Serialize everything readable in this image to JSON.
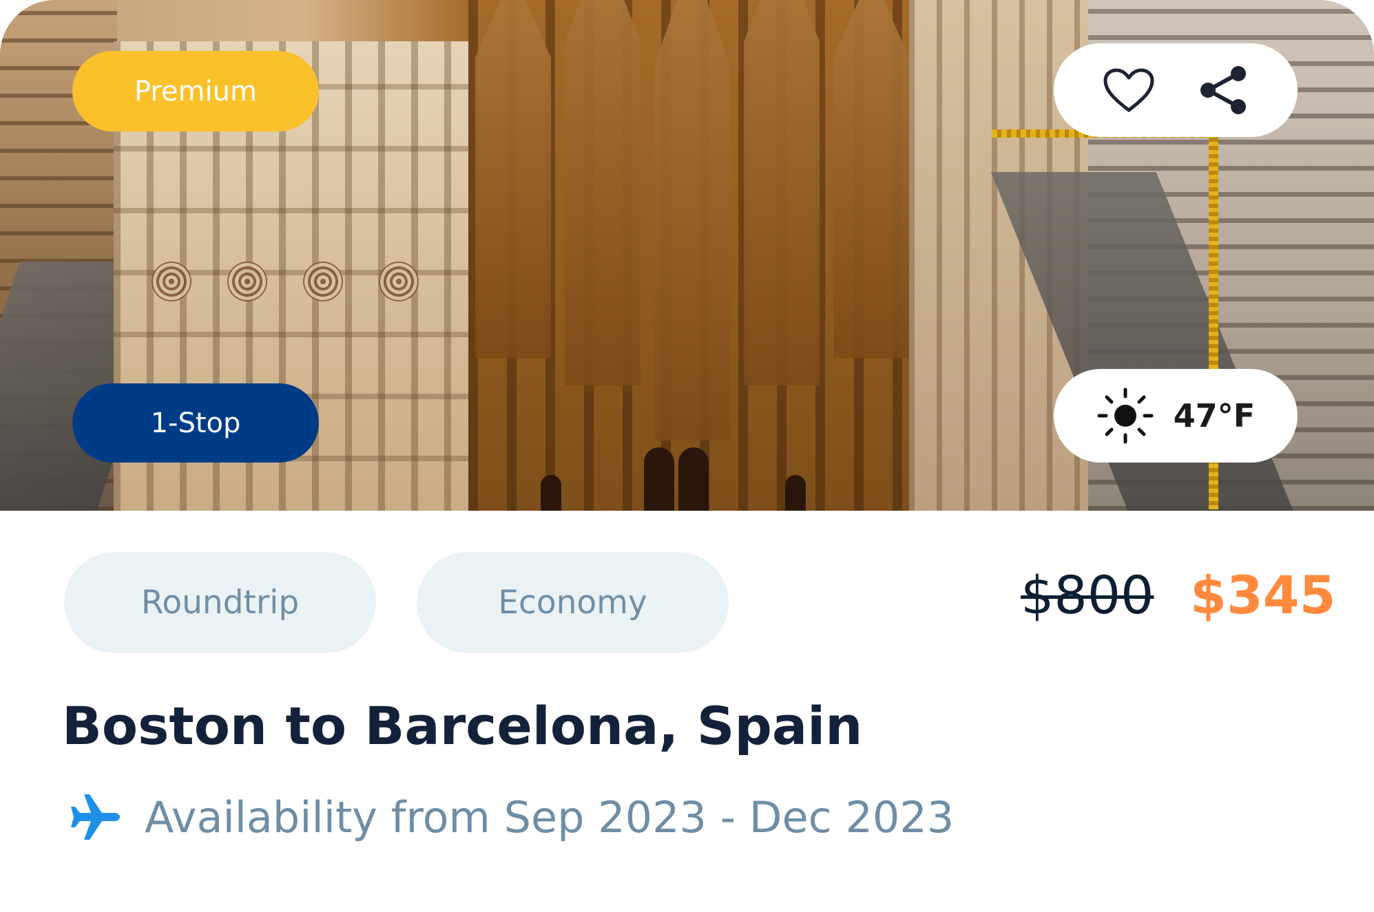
{
  "badges": {
    "tier_label": "Premium",
    "stops_label": "1-Stop"
  },
  "hero": {
    "subject": "Sagrada Familia aerial view"
  },
  "actions": {
    "favorite_icon": "heart-icon",
    "share_icon": "share-icon"
  },
  "weather": {
    "icon": "sun-icon",
    "temperature": "47°F"
  },
  "chips": [
    {
      "label": "Roundtrip"
    },
    {
      "label": "Economy"
    }
  ],
  "price": {
    "original": "$800",
    "current": "$345"
  },
  "trip": {
    "title": "Boston to Barcelona, Spain",
    "availability_icon": "airplane-icon",
    "availability": "Availability from Sep 2023 - Dec 2023"
  },
  "colors": {
    "premium_badge": "#fbc12b",
    "stop_badge": "#003c86",
    "price_accent": "#ff8a3d",
    "chip_bg": "#ebf2f5",
    "chip_text": "#6f8ea5",
    "title_text": "#14213a",
    "plane_icon": "#1e90e8"
  }
}
